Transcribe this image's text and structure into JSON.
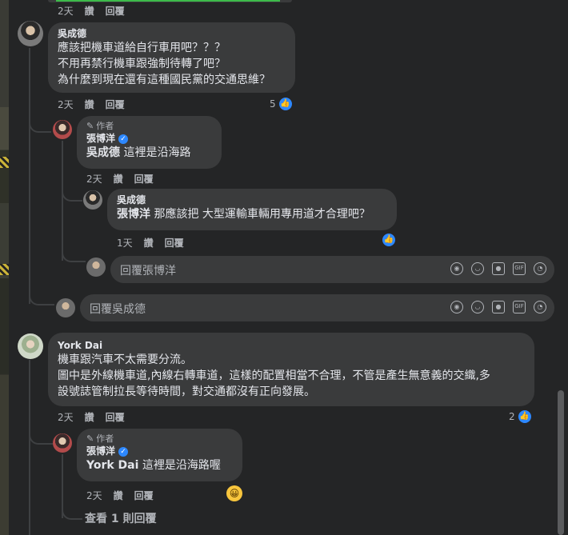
{
  "top_actions": {
    "time": "2天",
    "like": "讚",
    "reply": "回覆"
  },
  "comments": [
    {
      "author": "吳成德",
      "lines": [
        "應該把機車道給自行車用吧？？？",
        "不用再禁行機車跟強制待轉了吧？",
        "為什麼到現在還有這種國民黨的交通思維？"
      ],
      "time": "2天",
      "like": "讚",
      "reply": "回覆",
      "likes": "5",
      "replies": [
        {
          "author_badge": "作者",
          "author": "張博洋",
          "mention": "吳成德",
          "text": "這裡是沿海路￼",
          "time": "2天",
          "like": "讚",
          "reply": "回覆"
        },
        {
          "author": "吳成德",
          "mention": "張博洋",
          "text": "那應該把 大型運輸車輛用專用道才合理吧？",
          "time": "1天",
          "like": "讚",
          "reply": "回覆"
        }
      ],
      "reply_placeholder_inner": "回覆張博洋",
      "reply_placeholder_outer": "回覆吳成德"
    },
    {
      "author": "York Dai",
      "lines": [
        "機車跟汽車不太需要分流。",
        "圖中是外線機車道,內線右轉車道，這樣的配置相當不合理，不管是產生無意義的交織,多",
        "設號誌管制拉長等待時間，對交通都沒有正向發展。"
      ],
      "time": "2天",
      "like": "讚",
      "reply": "回覆",
      "likes": "2",
      "replies": [
        {
          "author_badge": "作者",
          "author": "張博洋",
          "mention": "York Dai",
          "text": "這裡是沿海路喔￼",
          "time": "2天",
          "like": "讚",
          "reply": "回覆"
        }
      ],
      "view_more": "查看 1 則回覆"
    }
  ],
  "colors": {
    "background": "#242526",
    "bubble": "#3a3b3c",
    "accent": "#2d88ff",
    "secondary_text": "#b0b3b8"
  },
  "icons": [
    "thumbs-up-icon",
    "verified-icon",
    "pencil-icon",
    "sticker-icon",
    "emoji-icon",
    "camera-icon",
    "gif-icon",
    "avatar-sticker-icon",
    "grinning-emoji-icon"
  ]
}
